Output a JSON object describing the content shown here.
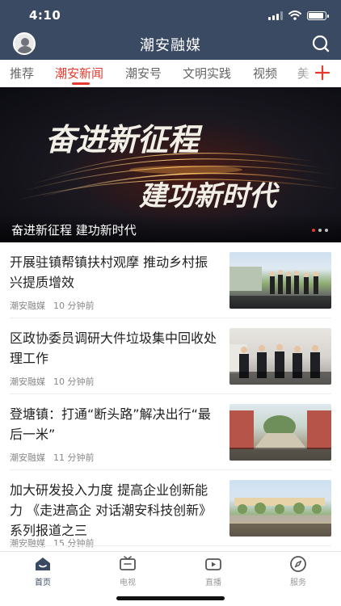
{
  "status_bar": {
    "time": "4:10",
    "battery_level": 0.9
  },
  "app_bar": {
    "title": "潮安融媒",
    "avatar": "user-avatar",
    "search_icon": "search-icon"
  },
  "tabs": {
    "items": [
      {
        "label": "推荐"
      },
      {
        "label": "潮安新闻",
        "active": true
      },
      {
        "label": "潮安号"
      },
      {
        "label": "文明实践"
      },
      {
        "label": "视频"
      },
      {
        "label": "美"
      }
    ],
    "add_icon": "plus-icon"
  },
  "banner": {
    "headline_line1": "奋进新征程",
    "headline_line2": "建功新时代",
    "caption": "奋进新征程 建功新时代",
    "slides": 3,
    "active_slide": 1
  },
  "news": [
    {
      "title": "开展驻镇帮镇扶村观摩 推动乡村振兴提质增效",
      "source": "潮安融媒",
      "time": "10 分钟前"
    },
    {
      "title": "区政协委员调研大件垃圾集中回收处理工作",
      "source": "潮安融媒",
      "time": "10 分钟前"
    },
    {
      "title": "登塘镇：打通“断头路”解决出行“最后一米”",
      "source": "潮安融媒",
      "time": "11 分钟前"
    },
    {
      "title": "加大研发投入力度 提高企业创新能力 《走进高企 对话潮安科技创新》系列报道之三",
      "source": "潮安融媒",
      "time": "15 分钟前"
    }
  ],
  "bottom_nav": {
    "items": [
      {
        "label": "首页",
        "icon": "home-icon",
        "active": true
      },
      {
        "label": "电视",
        "icon": "tv-icon"
      },
      {
        "label": "直播",
        "icon": "live-video-icon"
      },
      {
        "label": "服务",
        "icon": "compass-icon"
      }
    ]
  },
  "colors": {
    "header": "#3b4a63",
    "accent": "#e23b2e",
    "text": "#222222",
    "muted": "#888888"
  }
}
